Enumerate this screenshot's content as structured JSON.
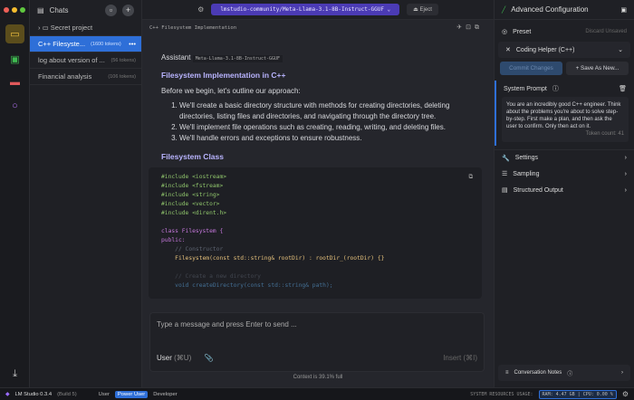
{
  "rail": {
    "icons": [
      "chat-icon",
      "terminal-icon",
      "folder-icon",
      "search-icon",
      "download-icon"
    ]
  },
  "chats": {
    "title": "Chats",
    "folder": "Secret project",
    "items": [
      {
        "title": "C++ Filesyste...",
        "tokens": "(1600 tokens)",
        "active": true
      },
      {
        "title": "log about version of ...",
        "tokens": "(56 tokens)"
      },
      {
        "title": "Financial analysis",
        "tokens": "(106 tokens)"
      }
    ]
  },
  "topbar": {
    "model": "lmstudio-community/Meta-Llama-3.1-8B-Instruct-GGUF",
    "eject": "Eject"
  },
  "main": {
    "chat_title": "C++ Filesystem Implementation",
    "role": "Assistant",
    "model_tag": "Meta-Llama-3.1-8B-Instruct-GGUF",
    "heading": "Filesystem Implementation in C++",
    "intro": "Before we begin, let's outline our approach:",
    "steps": [
      "We'll create a basic directory structure with methods for creating directories, deleting directories, listing files and directories, and navigating through the directory tree.",
      "We'll implement file operations such as creating, reading, writing, and deleting files.",
      "We'll handle errors and exceptions to ensure robustness."
    ],
    "section": "Filesystem Class",
    "code": [
      "#include <iostream>",
      "#include <fstream>",
      "#include <string>",
      "#include <vector>",
      "#include <dirent.h>",
      "",
      "class Filesystem {",
      "public:",
      "    // Constructor",
      "    Filesystem(const std::string& rootDir) : rootDir_(rootDir) {}",
      "",
      "    // Create a new directory",
      "    void createDirectory(const std::string& path);"
    ],
    "input_placeholder": "Type a message and press Enter to send ...",
    "user_label": "User",
    "user_shortcut": "(⌘U)",
    "insert_label": "Insert",
    "insert_shortcut": "(⌘I)",
    "context": "Context is 39.1% full"
  },
  "right": {
    "title": "Advanced Configuration",
    "preset_label": "Preset",
    "discard": "Discard Unsaved",
    "preset_value": "Coding Helper (C++)",
    "commit": "Commit Changes",
    "save_new": "+ Save As New...",
    "system_prompt_label": "System Prompt",
    "system_prompt": "You are an incredibly good C++ engineer. Think about the problems you're about to solve step-by-step. First make a plan, and then ask the user to confirm. Only then act on it.",
    "token_count": "Token count: 41",
    "sections": [
      "Settings",
      "Sampling",
      "Structured Output"
    ],
    "notes": "Conversation Notes"
  },
  "status": {
    "app": "LM Studio 0.3.4",
    "build": "(Build 5)",
    "modes": [
      "User",
      "Power User",
      "Developer"
    ],
    "active_mode": "Power User",
    "resources_label": "SYSTEM RESOURCES USAGE:",
    "resources": "RAM: 4.47 GB | CPU: 0.00 %"
  },
  "colors": {
    "accent": "#2e6fd8",
    "model_pill": "#4b3bb5",
    "heading": "#b9b4ff"
  }
}
